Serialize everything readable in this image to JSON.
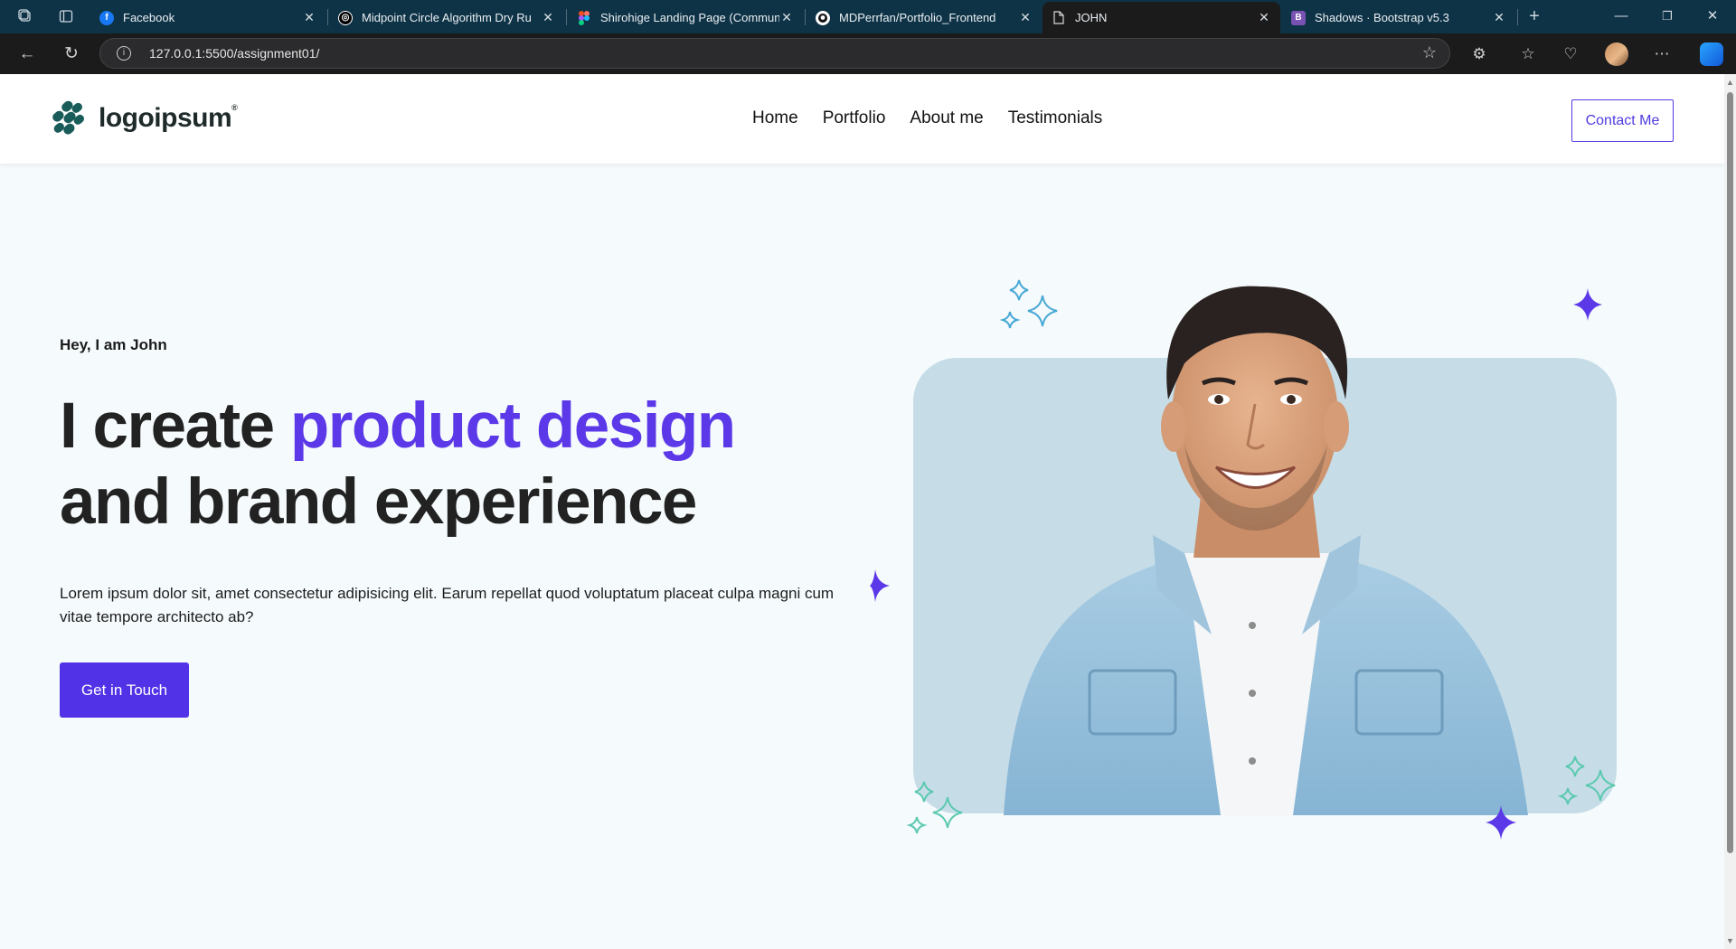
{
  "browser": {
    "tabs": [
      {
        "title": "Facebook",
        "favicon": "facebook-icon",
        "color": "#1877f2",
        "active": false
      },
      {
        "title": "Midpoint Circle Algorithm Dry Ru",
        "favicon": "chatgpt-icon",
        "color": "#ffffff",
        "active": false
      },
      {
        "title": "Shirohige Landing Page (Commun",
        "favicon": "figma-icon",
        "color": "#a259ff",
        "active": false
      },
      {
        "title": "MDPerrfan/Portfolio_Frontend",
        "favicon": "github-icon",
        "color": "#ffffff",
        "active": false
      },
      {
        "title": "JOHN",
        "favicon": "page-icon",
        "color": "#ffffff",
        "active": true
      },
      {
        "title": "Shadows · Bootstrap v5.3",
        "favicon": "bootstrap-icon",
        "color": "#7952b3",
        "active": false
      }
    ],
    "url": "127.0.0.1:5500/assignment01/"
  },
  "site": {
    "logo_text": "logoipsum",
    "logo_mark": "®",
    "nav": [
      "Home",
      "Portfolio",
      "About me",
      "Testimonials"
    ],
    "contact_label": "Contact Me"
  },
  "hero": {
    "greeting": "Hey, I am John",
    "headline_start": "I create ",
    "headline_accent": "product design",
    "headline_end": "and brand experience",
    "body": "Lorem ipsum dolor sit, amet consectetur adipisicing elit. Earum repellat quod voluptatum placeat culpa magni cum vitae tempore architecto ab?",
    "cta_label": "Get in Touch",
    "accent_color": "#5b38e8",
    "card_color": "#c6dde8"
  }
}
